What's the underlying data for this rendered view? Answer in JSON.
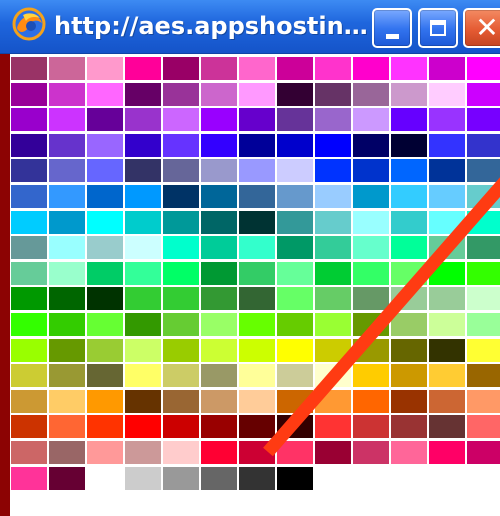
{
  "window": {
    "title": "http://aes.appshosting..."
  },
  "icons": {
    "app": "firefox-style-globe-icon",
    "minimize": "minimize-icon",
    "maximize": "maximize-icon",
    "close": "close-icon",
    "annotation": "diagonal-slash-icon"
  },
  "colors": {
    "frame": "#8c0303",
    "titlebar": "#1f66dd",
    "close_button": "#e55b33",
    "annotation": "#ff3b12"
  },
  "palette": {
    "rows": [
      [
        "#993366",
        "#cc6699",
        "#ff99cc",
        "#ff0099",
        "#990066",
        "#cc3399",
        "#ff66cc",
        "#cc0099",
        "#ff33cc",
        "#ff00cc",
        "#ff33ff",
        "#cc00cc",
        "#ff00ff"
      ],
      [
        "#990099",
        "#cc33cc",
        "#ff66ff",
        "#660066",
        "#993399",
        "#cc66cc",
        "#ff99ff",
        "#330033",
        "#663366",
        "#996699",
        "#cc99cc",
        "#ffccff",
        "#cc00ff"
      ],
      [
        "#9900cc",
        "#cc33ff",
        "#660099",
        "#9933cc",
        "#cc66ff",
        "#9900ff",
        "#6600cc",
        "#663399",
        "#9966cc",
        "#cc99ff",
        "#6600ff",
        "#9933ff",
        "#7700ff"
      ],
      [
        "#330099",
        "#6633cc",
        "#9966ff",
        "#3300cc",
        "#6633ff",
        "#3300ff",
        "#000099",
        "#0000cc",
        "#0000ff",
        "#000066",
        "#000033",
        "#3333ff",
        "#3333cc"
      ],
      [
        "#333399",
        "#6666cc",
        "#6666ff",
        "#333366",
        "#666699",
        "#9999cc",
        "#9999ff",
        "#ccccff",
        "#0033ff",
        "#0033cc",
        "#0066ff",
        "#003399",
        "#336699"
      ],
      [
        "#3366cc",
        "#3399ff",
        "#0066cc",
        "#0099ff",
        "#003366",
        "#006699",
        "#336699",
        "#6699cc",
        "#99ccff",
        "#0099cc",
        "#33ccff",
        "#66ccff",
        "#66cccc"
      ],
      [
        "#00ccff",
        "#0099cc",
        "#00ffff",
        "#00cccc",
        "#009999",
        "#006666",
        "#003333",
        "#339999",
        "#66cccc",
        "#99ffff",
        "#33cccc",
        "#66ffff",
        "#00ffcc"
      ],
      [
        "#669999",
        "#99ffff",
        "#99cccc",
        "#ccffff",
        "#00ffcc",
        "#00cc99",
        "#33ffcc",
        "#009966",
        "#33cc99",
        "#66ffcc",
        "#00ff99",
        "#66cc99",
        "#339966"
      ],
      [
        "#66cc99",
        "#99ffcc",
        "#00cc66",
        "#33ff99",
        "#00ff66",
        "#009933",
        "#33cc66",
        "#66ff99",
        "#00cc33",
        "#33ff66",
        "#66ff66",
        "#00ff00",
        "#33ff00"
      ],
      [
        "#009900",
        "#006600",
        "#003300",
        "#33cc33",
        "#33cc33",
        "#339933",
        "#336633",
        "#66ff66",
        "#66cc66",
        "#669966",
        "#99cc99",
        "#99cc99",
        "#ccffcc"
      ],
      [
        "#33ff00",
        "#33cc00",
        "#66ff33",
        "#339900",
        "#66cc33",
        "#99ff66",
        "#66ff00",
        "#66cc00",
        "#99ff33",
        "#669900",
        "#99cc66",
        "#ccff99",
        "#99ff99"
      ],
      [
        "#99ff00",
        "#669900",
        "#99cc33",
        "#ccff66",
        "#99cc00",
        "#ccff33",
        "#ccff00",
        "#ffff00",
        "#cccc00",
        "#999900",
        "#666600",
        "#333300",
        "#ffff33"
      ],
      [
        "#cccc33",
        "#999933",
        "#666633",
        "#ffff66",
        "#cccc66",
        "#999966",
        "#ffff99",
        "#cccc99",
        "#ffffcc",
        "#ffcc00",
        "#cc9900",
        "#ffcc33",
        "#996600"
      ],
      [
        "#cc9933",
        "#ffcc66",
        "#ff9900",
        "#663300",
        "#996633",
        "#cc9966",
        "#ffcc99",
        "#cc6600",
        "#ff9933",
        "#ff6600",
        "#993300",
        "#cc6633",
        "#ff9966"
      ],
      [
        "#cc3300",
        "#ff6633",
        "#ff3300",
        "#ff0000",
        "#cc0000",
        "#990000",
        "#660000",
        "#330000",
        "#ff3333",
        "#cc3333",
        "#993333",
        "#663333",
        "#ff6666"
      ],
      [
        "#cc6666",
        "#996666",
        "#ff9999",
        "#cc9999",
        "#ffcccc",
        "#ff0033",
        "#cc0033",
        "#ff3366",
        "#990033",
        "#cc3366",
        "#ff6699",
        "#ff0066",
        "#cc0066"
      ],
      [
        "#ff3399",
        "#660033",
        "#ffffff",
        "#cccccc",
        "#999999",
        "#666666",
        "#333333",
        "#000000",
        "",
        "",
        "",
        "",
        ""
      ]
    ]
  }
}
